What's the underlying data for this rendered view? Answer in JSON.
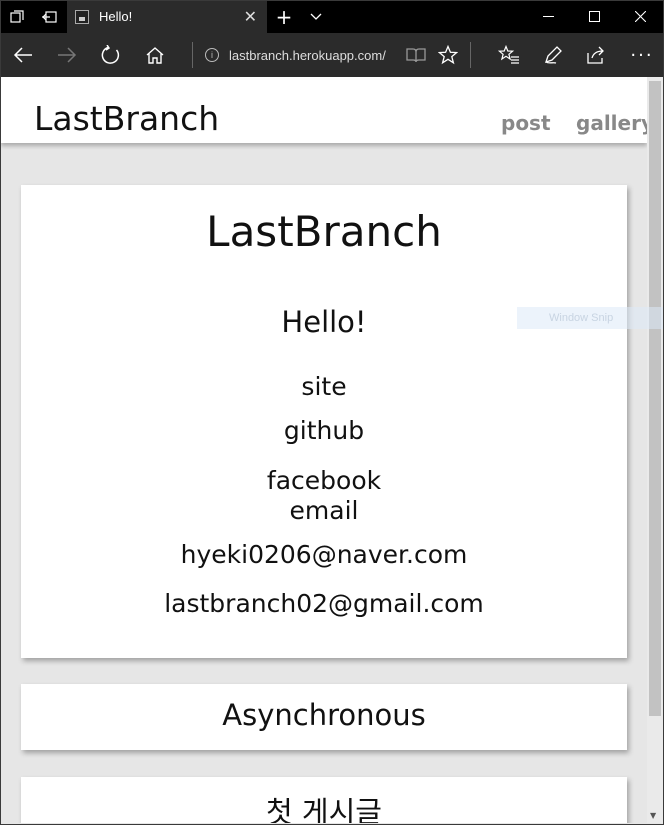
{
  "browser": {
    "tab_title": "Hello!",
    "address": "lastbranch.herokuapp.com/",
    "icons": [
      "tab-manager-icon",
      "set-aside-tabs-icon",
      "new-tab-icon",
      "tab-list-icon",
      "minimize-icon",
      "maximize-icon",
      "window-close-icon",
      "back-icon",
      "forward-icon",
      "refresh-icon",
      "home-icon",
      "info-icon",
      "reading-view-icon",
      "favorite-icon",
      "favorites-hub-icon",
      "web-note-icon",
      "share-icon",
      "more-icon"
    ]
  },
  "site": {
    "brand": "LastBranch",
    "nav": [
      "post",
      "gallery"
    ]
  },
  "profile": {
    "title": "LastBranch",
    "greeting": "Hello!",
    "links": [
      "site",
      "github",
      "facebook"
    ],
    "email_label": "email",
    "emails": [
      "hyeki0206@naver.com",
      "lastbranch02@gmail.com"
    ]
  },
  "posts": [
    {
      "title": "Asynchronous"
    },
    {
      "title": "첫 게시글"
    }
  ],
  "overlay": {
    "snip_label": "Window Snip"
  },
  "colors": {
    "page_bg": "#e6e6e6",
    "chrome_dark": "#2b2b2b",
    "title_black": "#000000",
    "nav_link": "#888888"
  }
}
